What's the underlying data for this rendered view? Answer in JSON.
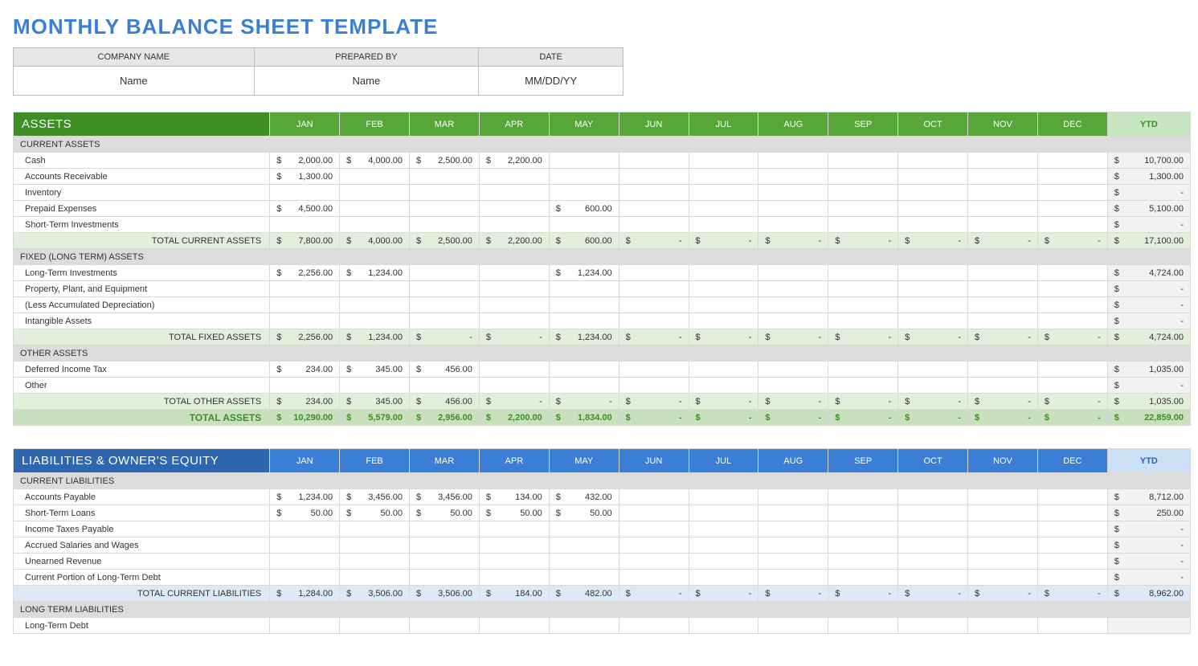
{
  "title": "MONTHLY BALANCE SHEET TEMPLATE",
  "info": {
    "headers": [
      "COMPANY NAME",
      "PREPARED BY",
      "DATE"
    ],
    "values": [
      "Name",
      "Name",
      "MM/DD/YY"
    ]
  },
  "months": [
    "JAN",
    "FEB",
    "MAR",
    "APR",
    "MAY",
    "JUN",
    "JUL",
    "AUG",
    "SEP",
    "OCT",
    "NOV",
    "DEC"
  ],
  "ytd_label": "YTD",
  "assets": {
    "title": "ASSETS",
    "sections": [
      {
        "name": "CURRENT ASSETS",
        "rows": [
          {
            "label": "Cash",
            "vals": [
              "2,000.00",
              "4,000.00",
              "2,500.00",
              "2,200.00",
              "",
              "",
              "",
              "",
              "",
              "",
              "",
              ""
            ],
            "ytd": "10,700.00"
          },
          {
            "label": "Accounts Receivable",
            "vals": [
              "1,300.00",
              "",
              "",
              "",
              "",
              "",
              "",
              "",
              "",
              "",
              "",
              ""
            ],
            "ytd": "1,300.00"
          },
          {
            "label": "Inventory",
            "vals": [
              "",
              "",
              "",
              "",
              "",
              "",
              "",
              "",
              "",
              "",
              "",
              ""
            ],
            "ytd": "-"
          },
          {
            "label": "Prepaid Expenses",
            "vals": [
              "4,500.00",
              "",
              "",
              "",
              "600.00",
              "",
              "",
              "",
              "",
              "",
              "",
              ""
            ],
            "ytd": "5,100.00"
          },
          {
            "label": "Short-Term Investments",
            "vals": [
              "",
              "",
              "",
              "",
              "",
              "",
              "",
              "",
              "",
              "",
              "",
              ""
            ],
            "ytd": "-"
          }
        ],
        "subtotal": {
          "label": "TOTAL CURRENT ASSETS",
          "vals": [
            "7,800.00",
            "4,000.00",
            "2,500.00",
            "2,200.00",
            "600.00",
            "-",
            "-",
            "-",
            "-",
            "-",
            "-",
            "-"
          ],
          "ytd": "17,100.00"
        }
      },
      {
        "name": "FIXED (LONG TERM) ASSETS",
        "rows": [
          {
            "label": "Long-Term Investments",
            "vals": [
              "2,256.00",
              "1,234.00",
              "",
              "",
              "1,234.00",
              "",
              "",
              "",
              "",
              "",
              "",
              ""
            ],
            "ytd": "4,724.00"
          },
          {
            "label": "Property, Plant, and Equipment",
            "vals": [
              "",
              "",
              "",
              "",
              "",
              "",
              "",
              "",
              "",
              "",
              "",
              ""
            ],
            "ytd": "-"
          },
          {
            "label": "(Less Accumulated Depreciation)",
            "vals": [
              "",
              "",
              "",
              "",
              "",
              "",
              "",
              "",
              "",
              "",
              "",
              ""
            ],
            "ytd": "-"
          },
          {
            "label": "Intangible Assets",
            "vals": [
              "",
              "",
              "",
              "",
              "",
              "",
              "",
              "",
              "",
              "",
              "",
              ""
            ],
            "ytd": "-"
          }
        ],
        "subtotal": {
          "label": "TOTAL FIXED ASSETS",
          "vals": [
            "2,256.00",
            "1,234.00",
            "-",
            "-",
            "1,234.00",
            "-",
            "-",
            "-",
            "-",
            "-",
            "-",
            "-"
          ],
          "ytd": "4,724.00"
        }
      },
      {
        "name": "OTHER ASSETS",
        "rows": [
          {
            "label": "Deferred Income Tax",
            "vals": [
              "234.00",
              "345.00",
              "456.00",
              "",
              "",
              "",
              "",
              "",
              "",
              "",
              "",
              ""
            ],
            "ytd": "1,035.00"
          },
          {
            "label": "Other",
            "vals": [
              "",
              "",
              "",
              "",
              "",
              "",
              "",
              "",
              "",
              "",
              "",
              ""
            ],
            "ytd": "-"
          }
        ],
        "subtotal": {
          "label": "TOTAL OTHER ASSETS",
          "vals": [
            "234.00",
            "345.00",
            "456.00",
            "-",
            "-",
            "-",
            "-",
            "-",
            "-",
            "-",
            "-",
            "-"
          ],
          "ytd": "1,035.00"
        }
      }
    ],
    "grand": {
      "label": "TOTAL ASSETS",
      "vals": [
        "10,290.00",
        "5,579.00",
        "2,956.00",
        "2,200.00",
        "1,834.00",
        "-",
        "-",
        "-",
        "-",
        "-",
        "-",
        "-"
      ],
      "ytd": "22,859.00"
    }
  },
  "liabilities": {
    "title": "LIABILITIES & OWNER'S EQUITY",
    "sections": [
      {
        "name": "CURRENT LIABILITIES",
        "rows": [
          {
            "label": "Accounts Payable",
            "vals": [
              "1,234.00",
              "3,456.00",
              "3,456.00",
              "134.00",
              "432.00",
              "",
              "",
              "",
              "",
              "",
              "",
              ""
            ],
            "ytd": "8,712.00"
          },
          {
            "label": "Short-Term Loans",
            "vals": [
              "50.00",
              "50.00",
              "50.00",
              "50.00",
              "50.00",
              "",
              "",
              "",
              "",
              "",
              "",
              ""
            ],
            "ytd": "250.00"
          },
          {
            "label": "Income Taxes Payable",
            "vals": [
              "",
              "",
              "",
              "",
              "",
              "",
              "",
              "",
              "",
              "",
              "",
              ""
            ],
            "ytd": "-"
          },
          {
            "label": "Accrued Salaries and Wages",
            "vals": [
              "",
              "",
              "",
              "",
              "",
              "",
              "",
              "",
              "",
              "",
              "",
              ""
            ],
            "ytd": "-"
          },
          {
            "label": "Unearned Revenue",
            "vals": [
              "",
              "",
              "",
              "",
              "",
              "",
              "",
              "",
              "",
              "",
              "",
              ""
            ],
            "ytd": "-"
          },
          {
            "label": "Current Portion of Long-Term Debt",
            "vals": [
              "",
              "",
              "",
              "",
              "",
              "",
              "",
              "",
              "",
              "",
              "",
              ""
            ],
            "ytd": "-"
          }
        ],
        "subtotal": {
          "label": "TOTAL CURRENT LIABILITIES",
          "vals": [
            "1,284.00",
            "3,506.00",
            "3,506.00",
            "184.00",
            "482.00",
            "-",
            "-",
            "-",
            "-",
            "-",
            "-",
            "-"
          ],
          "ytd": "8,962.00"
        }
      },
      {
        "name": "LONG TERM LIABILITIES",
        "rows": [
          {
            "label": "Long-Term Debt",
            "vals": [
              "",
              "",
              "",
              "",
              "",
              "",
              "",
              "",
              "",
              "",
              "",
              ""
            ],
            "ytd": ""
          }
        ]
      }
    ]
  }
}
